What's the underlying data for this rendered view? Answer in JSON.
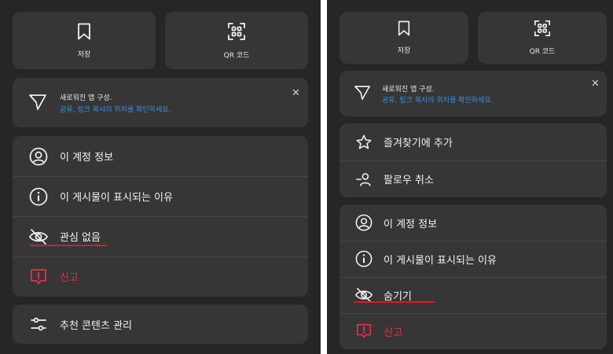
{
  "left": {
    "tiles": {
      "save_label": "저장",
      "qr_label": "QR 코드"
    },
    "notice": {
      "title": "새로워진 앱 구성.",
      "link": "공유, 링크 복사의 위치를 확인하세요."
    },
    "menu": {
      "account_info": "이 계정 정보",
      "why_seeing": "이 게시물이 표시되는 이유",
      "not_interested": "관심 없음",
      "report": "신고"
    },
    "manage_suggested": "추천 콘텐츠 관리"
  },
  "right": {
    "tiles": {
      "save_label": "저장",
      "qr_label": "QR 코드"
    },
    "notice": {
      "title": "새로워진 앱 구성.",
      "link": "공유, 링크 복사의 위치를 확인하세요."
    },
    "top_menu": {
      "add_favorites": "즐겨찾기에 추가",
      "unfollow": "팔로우 취소"
    },
    "menu": {
      "account_info": "이 계정 정보",
      "why_seeing": "이 게시물이 표시되는 이유",
      "hide": "숨기기",
      "report": "신고"
    }
  },
  "colors": {
    "panel_bg": "#262626",
    "card_bg": "#363636",
    "link": "#3a8fe0",
    "danger": "#ee2b4a",
    "highlight_underline": "#d81d1d"
  }
}
